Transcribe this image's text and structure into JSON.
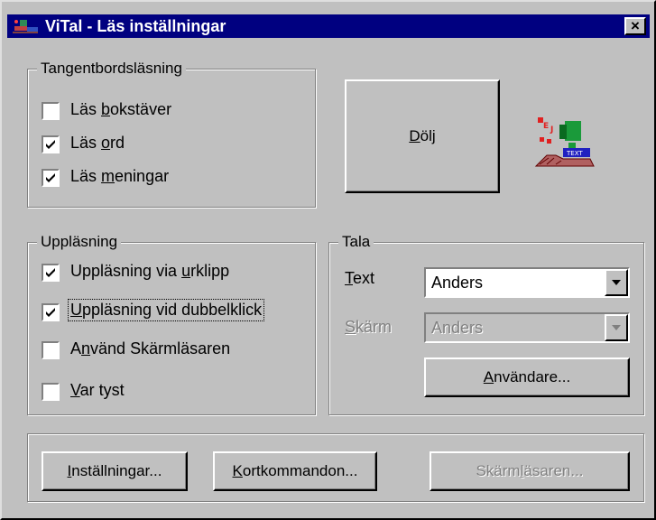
{
  "window": {
    "title": "ViTal - Läs inställningar",
    "close_label": "×"
  },
  "keyboard_group": {
    "legend": "Tangentbordsläsning",
    "items": [
      {
        "pre": "Läs ",
        "ul": "b",
        "post": "okstäver",
        "checked": false
      },
      {
        "pre": "Läs ",
        "ul": "o",
        "post": "rd",
        "checked": true
      },
      {
        "pre": "Läs ",
        "ul": "m",
        "post": "eningar",
        "checked": true
      }
    ]
  },
  "hide_button": {
    "pre": "",
    "ul": "D",
    "post": "ölj"
  },
  "reading_group": {
    "legend": "Uppläsning",
    "items": [
      {
        "pre": "Uppläsning via ",
        "ul": "u",
        "post": "rklipp",
        "checked": true
      },
      {
        "pre": "",
        "ul": "U",
        "post": "ppläsning vid dubbelklick",
        "checked": true,
        "focused": true
      },
      {
        "pre": "A",
        "ul": "n",
        "post": "vänd Skärmläsaren",
        "checked": false
      },
      {
        "pre": "",
        "ul": "V",
        "post": "ar tyst",
        "checked": false
      }
    ]
  },
  "speak_group": {
    "legend": "Tala",
    "text_label": {
      "pre": "",
      "ul": "T",
      "post": "ext"
    },
    "text_voice": "Anders",
    "screen_label": {
      "pre": "",
      "ul": "S",
      "post": "kärm"
    },
    "screen_voice": "Anders",
    "users_button": {
      "pre": "",
      "ul": "A",
      "post": "nvändare..."
    }
  },
  "bottom_buttons": {
    "settings": {
      "pre": "",
      "ul": "I",
      "post": "nställningar..."
    },
    "shortcuts": {
      "pre": "",
      "ul": "K",
      "post": "ortkommandon..."
    },
    "screenreader": {
      "pre": "Skärm",
      "ul": "l",
      "post": "äsaren..."
    }
  },
  "colors": {
    "titlebar": "#000080",
    "face": "#c0c0c0"
  }
}
